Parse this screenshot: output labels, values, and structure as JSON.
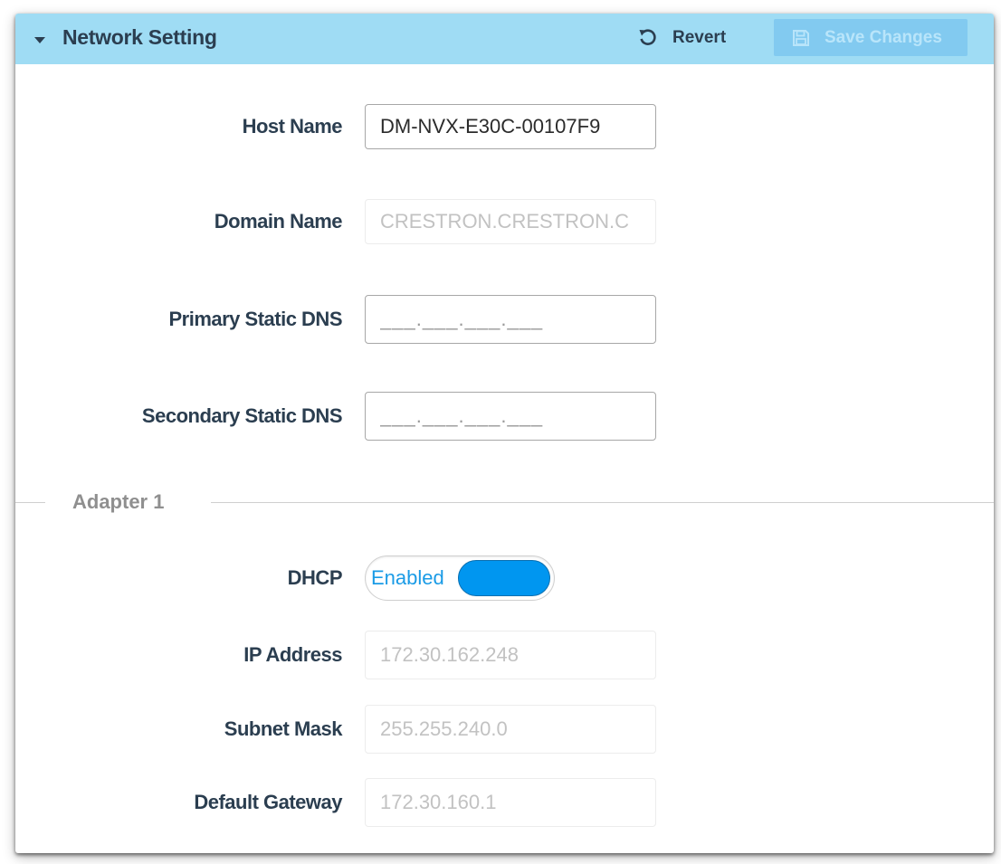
{
  "header": {
    "title": "Network Setting",
    "revert_label": "Revert",
    "save_label": "Save Changes"
  },
  "fields": {
    "host_name": {
      "label": "Host Name",
      "value": "DM-NVX-E30C-00107F9"
    },
    "domain_name": {
      "label": "Domain Name",
      "value": "CRESTRON.CRESTRON.C"
    },
    "primary_dns": {
      "label": "Primary Static DNS",
      "value": "___.___.___.___"
    },
    "secondary_dns": {
      "label": "Secondary Static DNS",
      "value": "___.___.___.___"
    }
  },
  "adapter": {
    "section_label": "Adapter 1",
    "dhcp": {
      "label": "DHCP",
      "state_label": "Enabled"
    },
    "ip_address": {
      "label": "IP Address",
      "value": "172.30.162.248"
    },
    "subnet_mask": {
      "label": "Subnet Mask",
      "value": "255.255.240.0"
    },
    "default_gateway": {
      "label": "Default Gateway",
      "value": "172.30.160.1"
    }
  },
  "colors": {
    "header_bg": "#9fdcf4",
    "text_dark": "#2b3e50",
    "toggle_on": "#0096f0",
    "save_disabled_bg": "#82caf0"
  },
  "icons": {
    "collapse": "caret-down-icon",
    "revert": "undo-icon",
    "save": "floppy-disk-icon"
  }
}
